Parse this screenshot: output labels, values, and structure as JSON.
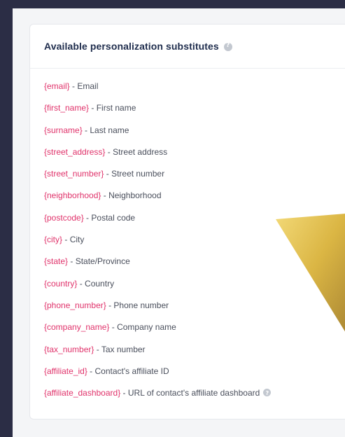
{
  "panel": {
    "title": "Available personalization substitutes",
    "help_icon": "help-circle-icon"
  },
  "substitutes": [
    {
      "token": "{email}",
      "desc": "Email"
    },
    {
      "token": "{first_name}",
      "desc": "First name"
    },
    {
      "token": "{surname}",
      "desc": "Last name"
    },
    {
      "token": "{street_address}",
      "desc": "Street address"
    },
    {
      "token": "{street_number}",
      "desc": "Street number"
    },
    {
      "token": "{neighborhood}",
      "desc": "Neighborhood"
    },
    {
      "token": "{postcode}",
      "desc": "Postal code"
    },
    {
      "token": "{city}",
      "desc": "City"
    },
    {
      "token": "{state}",
      "desc": "State/Province"
    },
    {
      "token": "{country}",
      "desc": "Country"
    },
    {
      "token": "{phone_number}",
      "desc": "Phone number"
    },
    {
      "token": "{company_name}",
      "desc": "Company name"
    },
    {
      "token": "{tax_number}",
      "desc": "Tax number"
    },
    {
      "token": "{affiliate_id}",
      "desc": "Contact's affiliate ID"
    },
    {
      "token": "{affiliate_dashboard}",
      "desc": "URL of contact's affiliate dashboard",
      "has_help": true
    }
  ],
  "separator": " - ",
  "colors": {
    "token": "#e0336b",
    "title": "#1f2d4d",
    "text": "#4a4f5c",
    "backdrop": "#2b2d45",
    "decor_gold": "#d9b23a"
  }
}
